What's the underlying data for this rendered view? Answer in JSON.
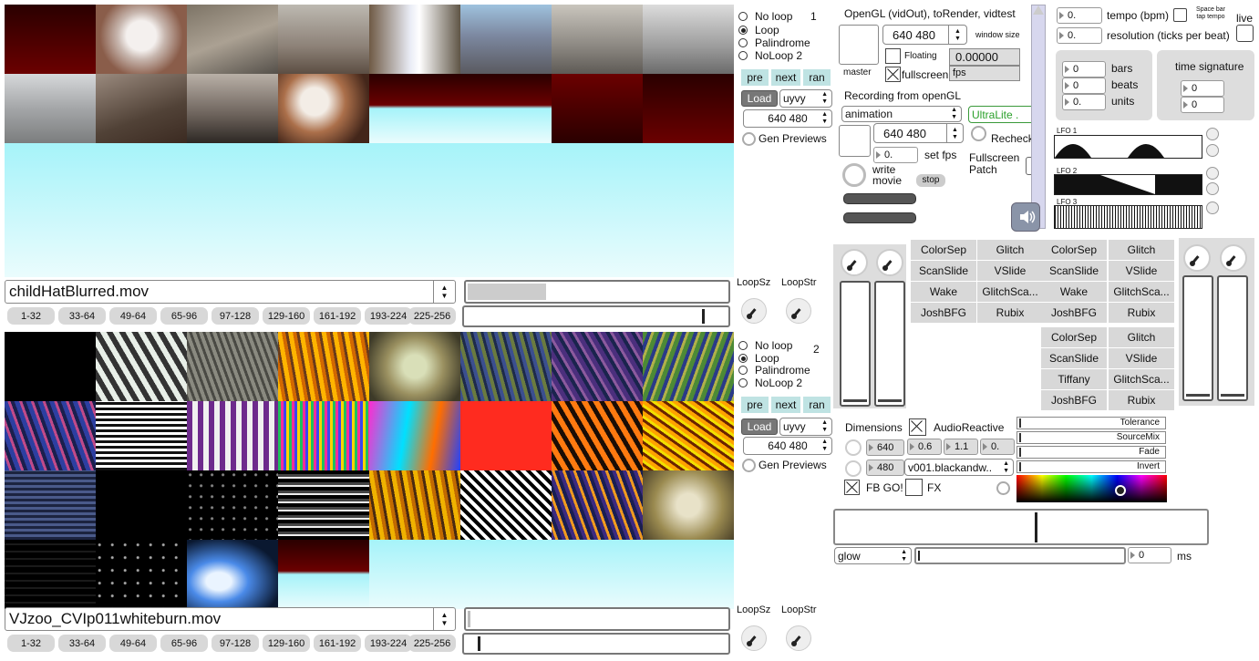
{
  "deck1": {
    "filename": "childHatBlurred.mov",
    "banks": [
      "1-32",
      "33-64",
      "49-64",
      "65-96",
      "97-128",
      "129-160",
      "161-192",
      "193-224",
      "225-256"
    ],
    "loop_modes": [
      "No loop",
      "Loop",
      "Palindrome",
      "NoLoop 2"
    ],
    "selected_mode": 1,
    "deck_number": "1",
    "nav": [
      "pre",
      "next",
      "ran"
    ],
    "load_label": "Load",
    "codec": "uyvy",
    "dims": "640 480",
    "gen_previews": "Gen Previews",
    "loopsz": "LoopSz",
    "loopstr": "LoopStr"
  },
  "deck2": {
    "filename": "VJzoo_CVIp011whiteburn.mov",
    "banks": [
      "1-32",
      "33-64",
      "49-64",
      "65-96",
      "97-128",
      "129-160",
      "161-192",
      "193-224",
      "225-256"
    ],
    "loop_modes": [
      "No loop",
      "Loop",
      "Palindrome",
      "NoLoop 2"
    ],
    "selected_mode": 1,
    "deck_number": "2",
    "nav": [
      "pre",
      "next",
      "ran"
    ],
    "load_label": "Load",
    "codec": "uyvy",
    "dims": "640 480",
    "gen_previews": "Gen Previews",
    "loopsz": "LoopSz",
    "loopstr": "LoopStr"
  },
  "opengl": {
    "title": "OpenGL (vidOut), toRender, vidtest",
    "dims": "640 480",
    "window_size": "window size",
    "floating": "Floating",
    "fps_value": "0.00000",
    "fps_label": "fps",
    "master": "master",
    "fullscreen": "fullscreen"
  },
  "recording": {
    "title": "Recording from openGL",
    "codec": "animation",
    "device": "UltraLite .",
    "dims": "640 480",
    "recheck": "Recheck",
    "fps_value": "0.",
    "set_fps": "set fps",
    "fullscreen_patch": "Fullscreen Patch",
    "write_movie": "write movie",
    "stop": "stop"
  },
  "tempo": {
    "tempo_value": "0.",
    "tempo_label": "tempo (bpm)",
    "spacebar": "Space bar tap tempo",
    "live": "live",
    "resolution_value": "0.",
    "resolution_label": "resolution (ticks per beat)",
    "bars": "0",
    "bars_label": "bars",
    "beats": "0",
    "beats_label": "beats",
    "units": "0.",
    "units_label": "units",
    "time_signature": "time signature",
    "ts_top": "0",
    "ts_bottom": "0"
  },
  "lfo": [
    "LFO 1",
    "LFO 2",
    "LFO 3"
  ],
  "effects_left": [
    "ColorSep",
    "Glitch",
    "ScanSlide",
    "VSlide",
    "Wake",
    "GlitchSca...",
    "JoshBFG",
    "Rubix"
  ],
  "effects_right": [
    "ColorSep",
    "Glitch",
    "ScanSlide",
    "VSlide",
    "Wake",
    "GlitchSca...",
    "JoshBFG",
    "Rubix"
  ],
  "effects_lower": [
    "ColorSep",
    "Glitch",
    "ScanSlide",
    "VSlide",
    "Tiffany",
    "GlitchSca...",
    "JoshBFG",
    "Rubix"
  ],
  "dimensions": {
    "label": "Dimensions",
    "audio_reactive": "AudioReactive",
    "width": "640",
    "height": "480",
    "v1": "0.6",
    "v2": "1.1",
    "v3": "0.",
    "shader": "v001.blackandw..",
    "fb_go": "FB GO!",
    "fx": "FX"
  },
  "sliders": [
    "Tolerance",
    "SourceMix",
    "Fade",
    "Invert"
  ],
  "glow": {
    "mode": "glow",
    "ms_value": "0",
    "ms_label": "ms"
  },
  "colors": {
    "accent": "#bfe3e3",
    "thumb_cyan": "#a6f3f9"
  }
}
